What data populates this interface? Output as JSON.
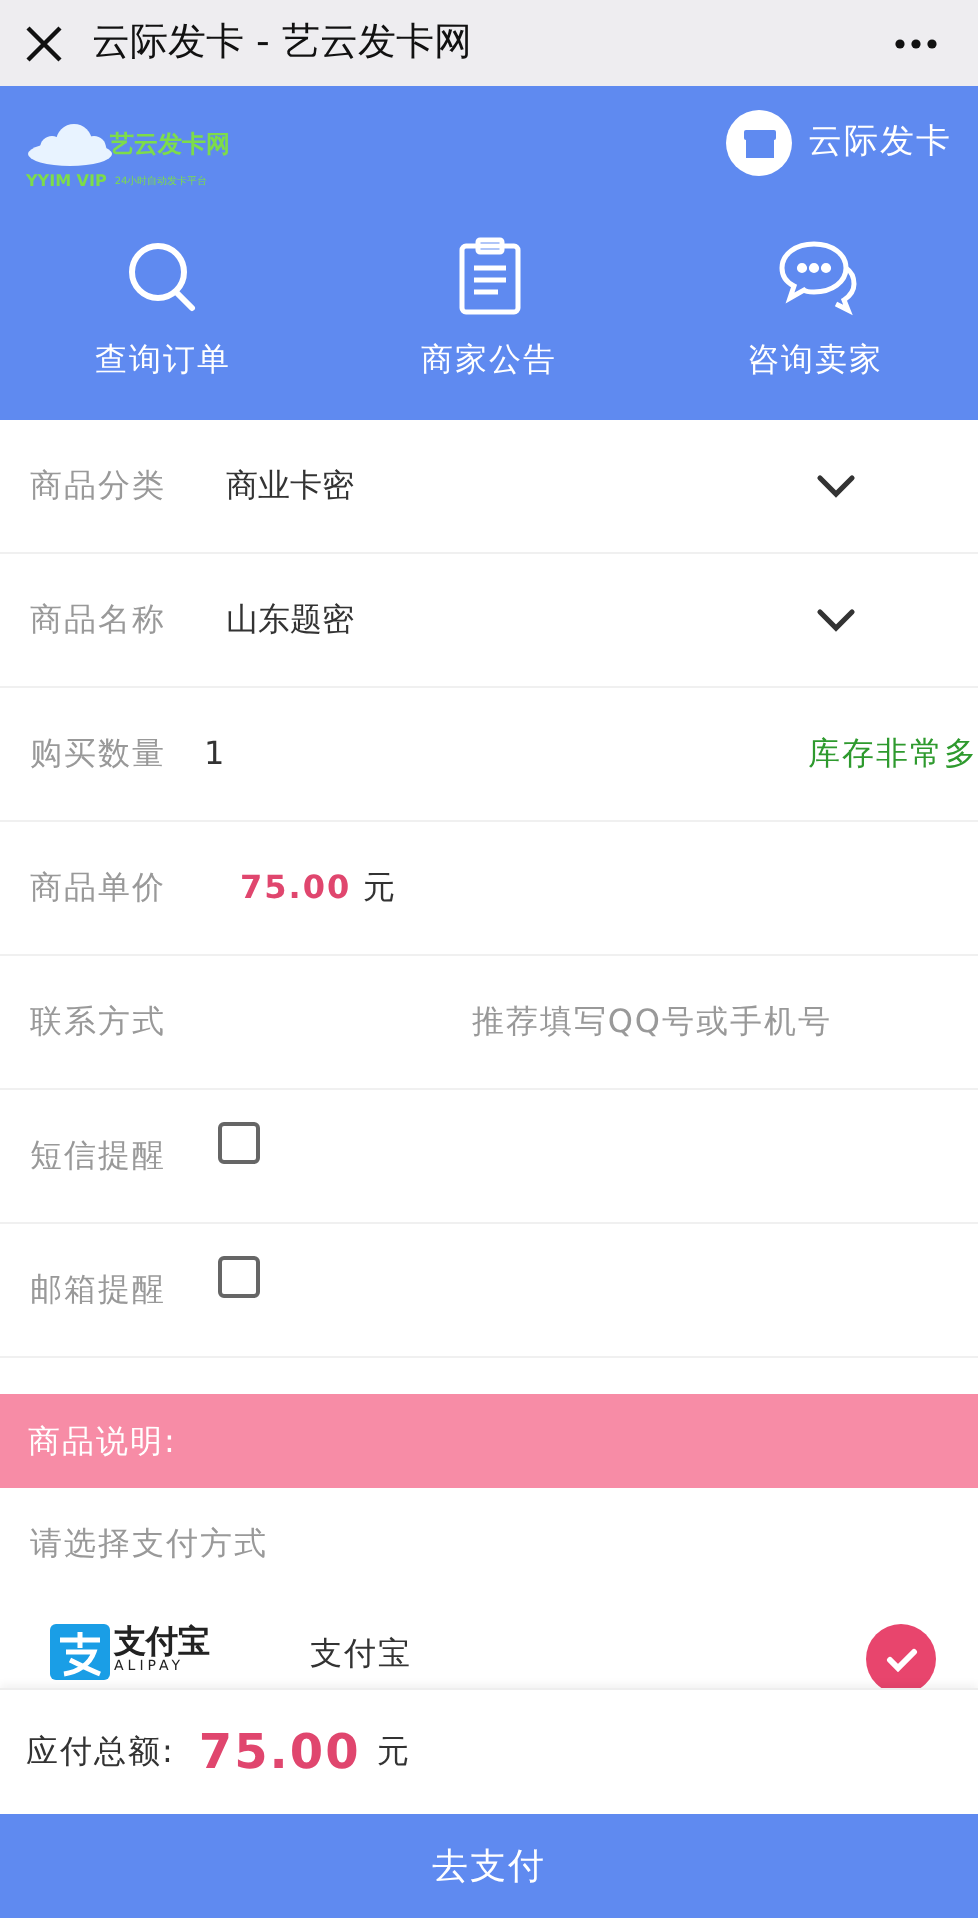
{
  "topbar": {
    "title": "云际发卡 - 艺云发卡网"
  },
  "header": {
    "logo": {
      "name": "艺云发卡网",
      "sub_left": "YYIM VIP",
      "sub_right": "24小时自动发卡平台"
    },
    "shop": "云际发卡",
    "nav": [
      {
        "kind": "search",
        "label": "查询订单"
      },
      {
        "kind": "notice",
        "label": "商家公告"
      },
      {
        "kind": "chat",
        "label": "咨询卖家"
      }
    ]
  },
  "form": [
    {
      "kind": "select",
      "label": "商品分类",
      "value": "商业卡密"
    },
    {
      "kind": "select",
      "label": "商品名称",
      "value": "山东题密"
    },
    {
      "kind": "quantity",
      "label": "购买数量",
      "value": "1",
      "stock": "库存非常多"
    },
    {
      "kind": "price",
      "label": "商品单价",
      "value": "75.00",
      "unit": "元"
    },
    {
      "kind": "input",
      "label": "联系方式",
      "placeholder": "推荐填写QQ号或手机号"
    },
    {
      "kind": "checkbox",
      "label": "短信提醒",
      "checked": false
    },
    {
      "kind": "checkbox",
      "label": "邮箱提醒",
      "checked": false
    }
  ],
  "description": {
    "title": "商品说明:"
  },
  "payment": {
    "prompt": "请选择支付方式",
    "methods": [
      {
        "logo_text": "支付宝",
        "logo_sub": "ALIPAY",
        "name": "支付宝",
        "selected": true
      }
    ]
  },
  "footer": {
    "label": "应付总额:",
    "amount": "75.00",
    "unit": "元",
    "button": "去支付"
  }
}
